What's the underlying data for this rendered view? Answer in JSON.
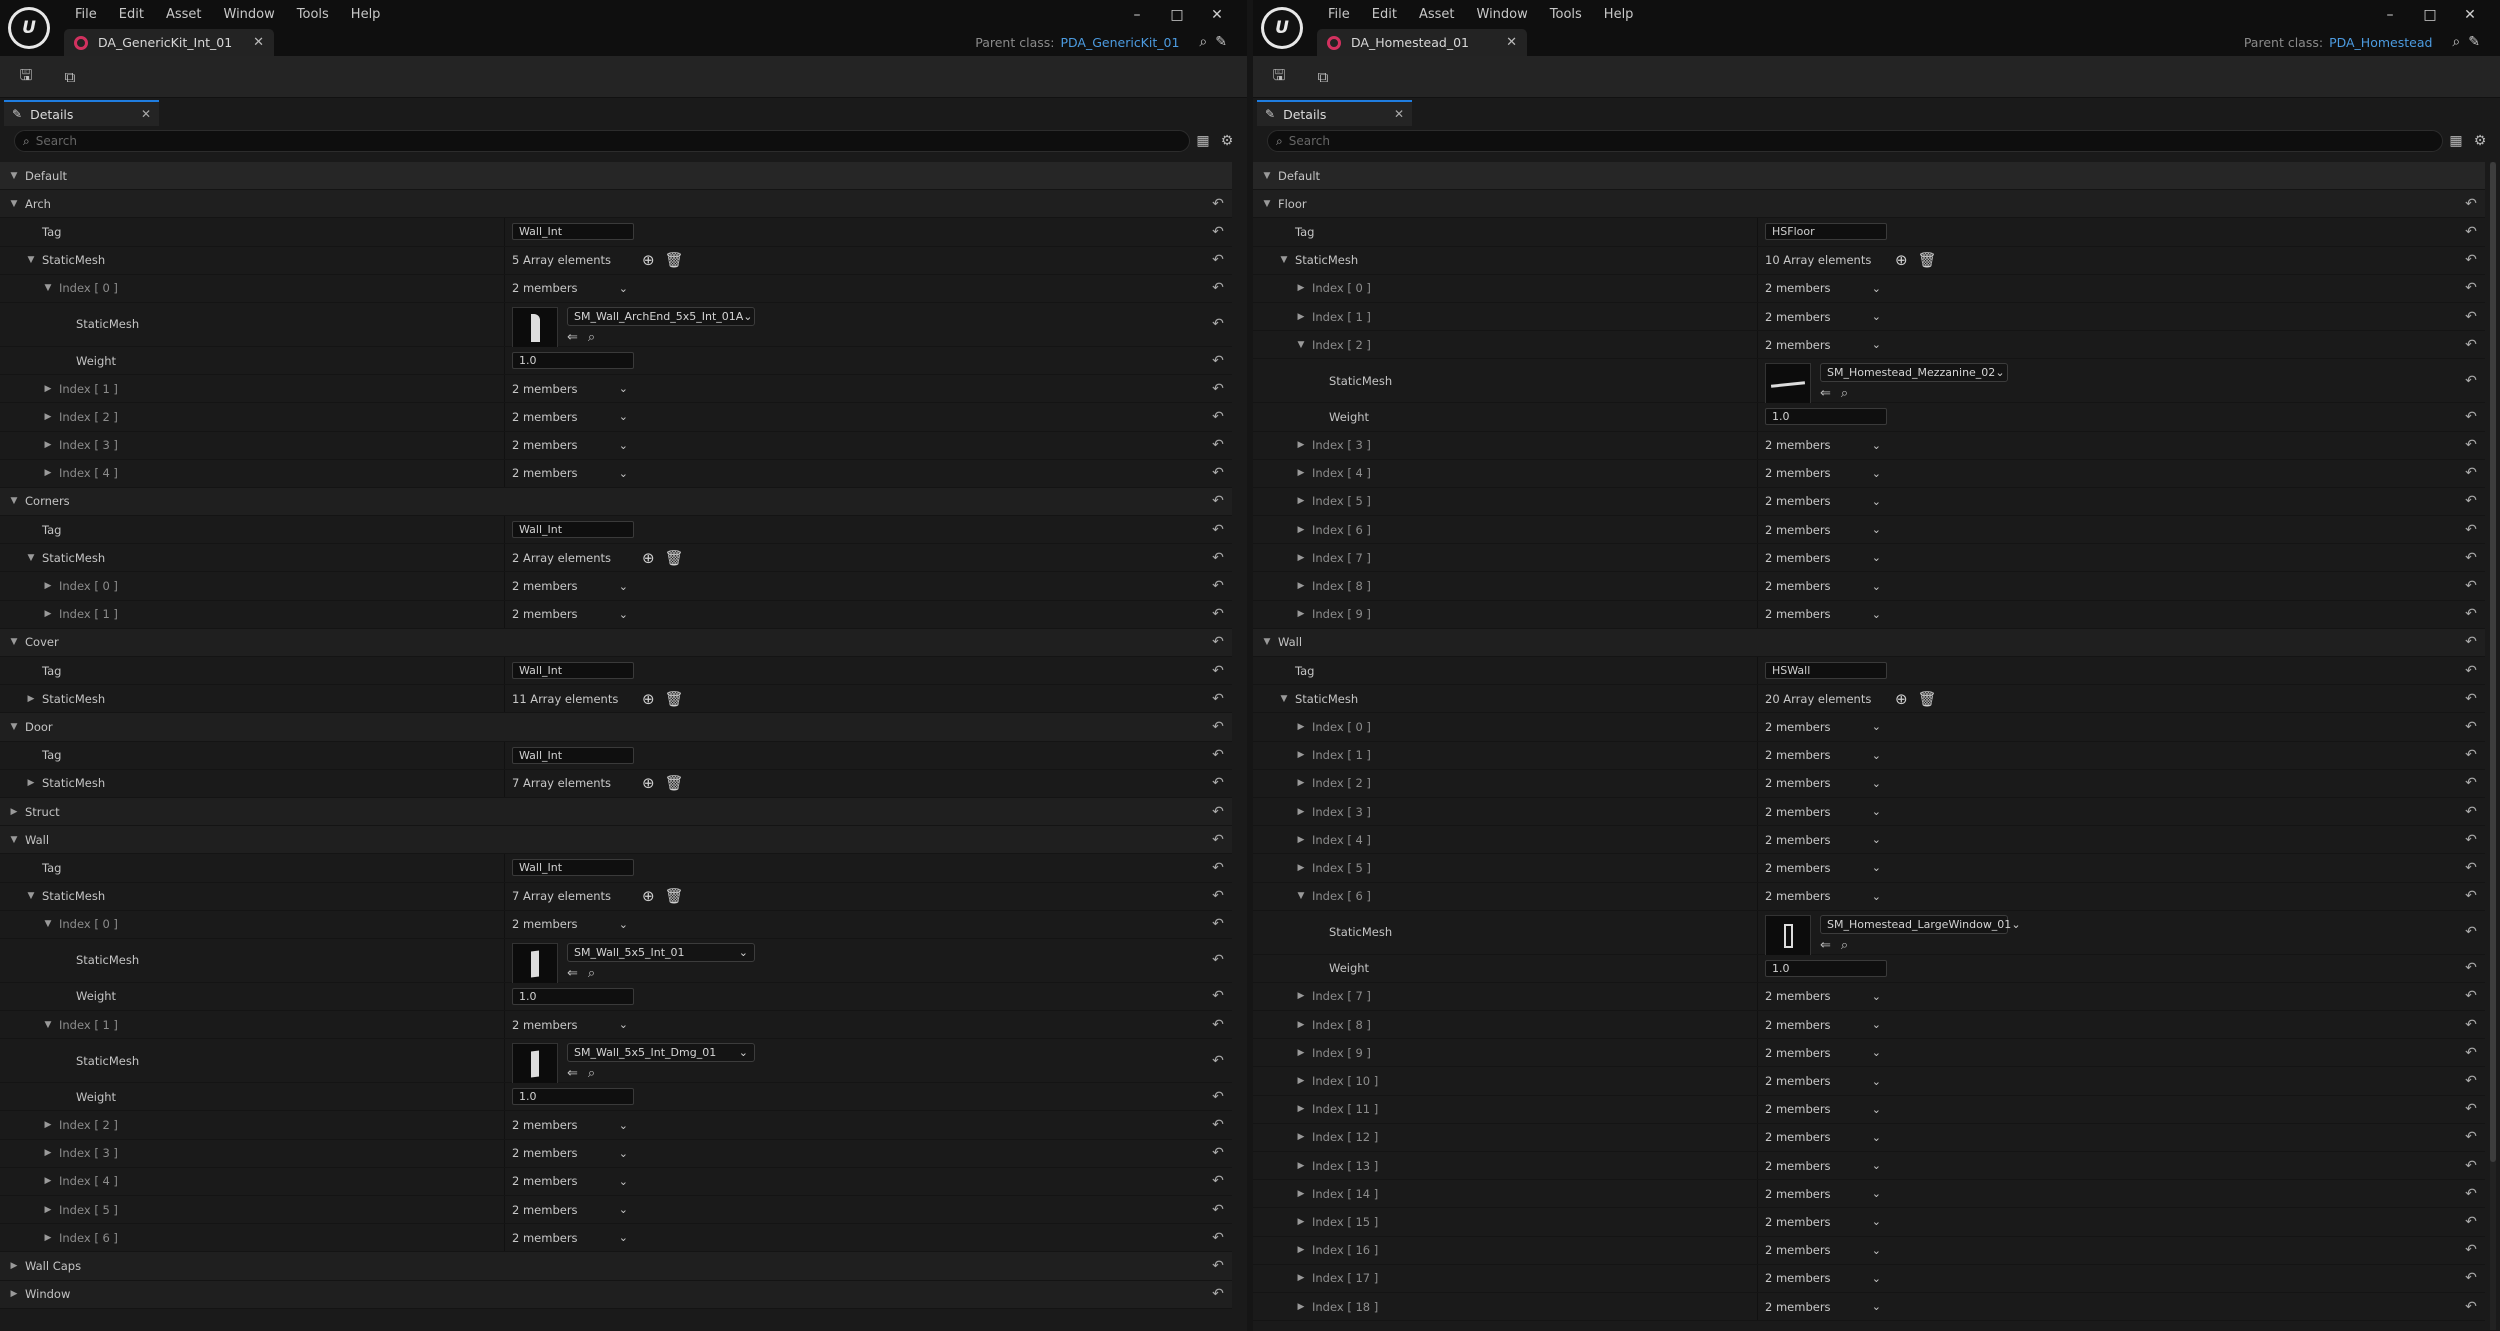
{
  "menu": [
    "File",
    "Edit",
    "Asset",
    "Window",
    "Tools",
    "Help"
  ],
  "window_buttons": [
    "–",
    "□",
    "✕"
  ],
  "panel_tab": "Details",
  "search_placeholder": "Search",
  "parent_class_label": "Parent class:",
  "left": {
    "doc_tab": "DA_GenericKit_Int_01",
    "parent_class": "PDA_GenericKit_01",
    "rows": [
      {
        "kind": "cat",
        "depth": 0,
        "tri": "down",
        "name": "Default"
      },
      {
        "kind": "sub",
        "depth": 0,
        "tri": "down",
        "name": "Arch"
      },
      {
        "kind": "prop",
        "depth": 1,
        "tri": "none",
        "name": "Tag",
        "val": "text",
        "text": "Wall_Int"
      },
      {
        "kind": "prop",
        "depth": 1,
        "tri": "down",
        "name": "StaticMesh",
        "val": "array",
        "text": "5 Array elements"
      },
      {
        "kind": "idx",
        "depth": 2,
        "tri": "down",
        "name": "Index [ 0 ]",
        "val": "members",
        "text": "2 members"
      },
      {
        "kind": "asset",
        "depth": 3,
        "tri": "none",
        "name": "StaticMesh",
        "val": "asset",
        "text": "SM_Wall_ArchEnd_5x5_Int_01A",
        "thumb": "arch"
      },
      {
        "kind": "prop",
        "depth": 3,
        "tri": "none",
        "name": "Weight",
        "val": "text",
        "text": "1.0"
      },
      {
        "kind": "idx",
        "depth": 2,
        "tri": "right",
        "name": "Index [ 1 ]",
        "val": "members",
        "text": "2 members"
      },
      {
        "kind": "idx",
        "depth": 2,
        "tri": "right",
        "name": "Index [ 2 ]",
        "val": "members",
        "text": "2 members"
      },
      {
        "kind": "idx",
        "depth": 2,
        "tri": "right",
        "name": "Index [ 3 ]",
        "val": "members",
        "text": "2 members"
      },
      {
        "kind": "idx",
        "depth": 2,
        "tri": "right",
        "name": "Index [ 4 ]",
        "val": "members",
        "text": "2 members"
      },
      {
        "kind": "sub",
        "depth": 0,
        "tri": "down",
        "name": "Corners"
      },
      {
        "kind": "prop",
        "depth": 1,
        "tri": "none",
        "name": "Tag",
        "val": "text",
        "text": "Wall_Int"
      },
      {
        "kind": "prop",
        "depth": 1,
        "tri": "down",
        "name": "StaticMesh",
        "val": "array",
        "text": "2 Array elements"
      },
      {
        "kind": "idx",
        "depth": 2,
        "tri": "right",
        "name": "Index [ 0 ]",
        "val": "members",
        "text": "2 members"
      },
      {
        "kind": "idx",
        "depth": 2,
        "tri": "right",
        "name": "Index [ 1 ]",
        "val": "members",
        "text": "2 members"
      },
      {
        "kind": "sub",
        "depth": 0,
        "tri": "down",
        "name": "Cover"
      },
      {
        "kind": "prop",
        "depth": 1,
        "tri": "none",
        "name": "Tag",
        "val": "text",
        "text": "Wall_Int"
      },
      {
        "kind": "prop",
        "depth": 1,
        "tri": "right",
        "name": "StaticMesh",
        "val": "array",
        "text": "11 Array elements"
      },
      {
        "kind": "sub",
        "depth": 0,
        "tri": "down",
        "name": "Door"
      },
      {
        "kind": "prop",
        "depth": 1,
        "tri": "none",
        "name": "Tag",
        "val": "text",
        "text": "Wall_Int"
      },
      {
        "kind": "prop",
        "depth": 1,
        "tri": "right",
        "name": "StaticMesh",
        "val": "array",
        "text": "7 Array elements"
      },
      {
        "kind": "sub",
        "depth": 0,
        "tri": "right",
        "name": "Struct"
      },
      {
        "kind": "sub",
        "depth": 0,
        "tri": "down",
        "name": "Wall"
      },
      {
        "kind": "prop",
        "depth": 1,
        "tri": "none",
        "name": "Tag",
        "val": "text",
        "text": "Wall_Int"
      },
      {
        "kind": "prop",
        "depth": 1,
        "tri": "down",
        "name": "StaticMesh",
        "val": "array",
        "text": "7 Array elements"
      },
      {
        "kind": "idx",
        "depth": 2,
        "tri": "down",
        "name": "Index [ 0 ]",
        "val": "members",
        "text": "2 members"
      },
      {
        "kind": "asset",
        "depth": 3,
        "tri": "none",
        "name": "StaticMesh",
        "val": "asset",
        "text": "SM_Wall_5x5_Int_01",
        "thumb": "wall"
      },
      {
        "kind": "prop",
        "depth": 3,
        "tri": "none",
        "name": "Weight",
        "val": "text",
        "text": "1.0"
      },
      {
        "kind": "idx",
        "depth": 2,
        "tri": "down",
        "name": "Index [ 1 ]",
        "val": "members",
        "text": "2 members"
      },
      {
        "kind": "asset",
        "depth": 3,
        "tri": "none",
        "name": "StaticMesh",
        "val": "asset",
        "text": "SM_Wall_5x5_Int_Dmg_01",
        "thumb": "wall"
      },
      {
        "kind": "prop",
        "depth": 3,
        "tri": "none",
        "name": "Weight",
        "val": "text",
        "text": "1.0"
      },
      {
        "kind": "idx",
        "depth": 2,
        "tri": "right",
        "name": "Index [ 2 ]",
        "val": "members",
        "text": "2 members"
      },
      {
        "kind": "idx",
        "depth": 2,
        "tri": "right",
        "name": "Index [ 3 ]",
        "val": "members",
        "text": "2 members"
      },
      {
        "kind": "idx",
        "depth": 2,
        "tri": "right",
        "name": "Index [ 4 ]",
        "val": "members",
        "text": "2 members"
      },
      {
        "kind": "idx",
        "depth": 2,
        "tri": "right",
        "name": "Index [ 5 ]",
        "val": "members",
        "text": "2 members"
      },
      {
        "kind": "idx",
        "depth": 2,
        "tri": "right",
        "name": "Index [ 6 ]",
        "val": "members",
        "text": "2 members"
      },
      {
        "kind": "sub",
        "depth": 0,
        "tri": "right",
        "name": "Wall Caps"
      },
      {
        "kind": "sub",
        "depth": 0,
        "tri": "right",
        "name": "Window"
      }
    ]
  },
  "right": {
    "doc_tab": "DA_Homestead_01",
    "parent_class": "PDA_Homestead",
    "rows": [
      {
        "kind": "cat",
        "depth": 0,
        "tri": "down",
        "name": "Default"
      },
      {
        "kind": "sub",
        "depth": 0,
        "tri": "down",
        "name": "Floor"
      },
      {
        "kind": "prop",
        "depth": 1,
        "tri": "none",
        "name": "Tag",
        "val": "text",
        "text": "HSFloor"
      },
      {
        "kind": "prop",
        "depth": 1,
        "tri": "down",
        "name": "StaticMesh",
        "val": "array",
        "text": "10 Array elements"
      },
      {
        "kind": "idx",
        "depth": 2,
        "tri": "right",
        "name": "Index [ 0 ]",
        "val": "members",
        "text": "2 members"
      },
      {
        "kind": "idx",
        "depth": 2,
        "tri": "right",
        "name": "Index [ 1 ]",
        "val": "members",
        "text": "2 members"
      },
      {
        "kind": "idx",
        "depth": 2,
        "tri": "down",
        "name": "Index [ 2 ]",
        "val": "members",
        "text": "2 members"
      },
      {
        "kind": "asset",
        "depth": 3,
        "tri": "none",
        "name": "StaticMesh",
        "val": "asset",
        "text": "SM_Homestead_Mezzanine_02",
        "thumb": "flat"
      },
      {
        "kind": "prop",
        "depth": 3,
        "tri": "none",
        "name": "Weight",
        "val": "text",
        "text": "1.0"
      },
      {
        "kind": "idx",
        "depth": 2,
        "tri": "right",
        "name": "Index [ 3 ]",
        "val": "members",
        "text": "2 members"
      },
      {
        "kind": "idx",
        "depth": 2,
        "tri": "right",
        "name": "Index [ 4 ]",
        "val": "members",
        "text": "2 members"
      },
      {
        "kind": "idx",
        "depth": 2,
        "tri": "right",
        "name": "Index [ 5 ]",
        "val": "members",
        "text": "2 members"
      },
      {
        "kind": "idx",
        "depth": 2,
        "tri": "right",
        "name": "Index [ 6 ]",
        "val": "members",
        "text": "2 members"
      },
      {
        "kind": "idx",
        "depth": 2,
        "tri": "right",
        "name": "Index [ 7 ]",
        "val": "members",
        "text": "2 members"
      },
      {
        "kind": "idx",
        "depth": 2,
        "tri": "right",
        "name": "Index [ 8 ]",
        "val": "members",
        "text": "2 members"
      },
      {
        "kind": "idx",
        "depth": 2,
        "tri": "right",
        "name": "Index [ 9 ]",
        "val": "members",
        "text": "2 members"
      },
      {
        "kind": "sub",
        "depth": 0,
        "tri": "down",
        "name": "Wall"
      },
      {
        "kind": "prop",
        "depth": 1,
        "tri": "none",
        "name": "Tag",
        "val": "text",
        "text": "HSWall"
      },
      {
        "kind": "prop",
        "depth": 1,
        "tri": "down",
        "name": "StaticMesh",
        "val": "array",
        "text": "20 Array elements"
      },
      {
        "kind": "idx",
        "depth": 2,
        "tri": "right",
        "name": "Index [ 0 ]",
        "val": "members",
        "text": "2 members"
      },
      {
        "kind": "idx",
        "depth": 2,
        "tri": "right",
        "name": "Index [ 1 ]",
        "val": "members",
        "text": "2 members"
      },
      {
        "kind": "idx",
        "depth": 2,
        "tri": "right",
        "name": "Index [ 2 ]",
        "val": "members",
        "text": "2 members"
      },
      {
        "kind": "idx",
        "depth": 2,
        "tri": "right",
        "name": "Index [ 3 ]",
        "val": "members",
        "text": "2 members"
      },
      {
        "kind": "idx",
        "depth": 2,
        "tri": "right",
        "name": "Index [ 4 ]",
        "val": "members",
        "text": "2 members"
      },
      {
        "kind": "idx",
        "depth": 2,
        "tri": "right",
        "name": "Index [ 5 ]",
        "val": "members",
        "text": "2 members"
      },
      {
        "kind": "idx",
        "depth": 2,
        "tri": "down",
        "name": "Index [ 6 ]",
        "val": "members",
        "text": "2 members"
      },
      {
        "kind": "asset",
        "depth": 3,
        "tri": "none",
        "name": "StaticMesh",
        "val": "asset",
        "text": "SM_Homestead_LargeWindow_01",
        "thumb": "window"
      },
      {
        "kind": "prop",
        "depth": 3,
        "tri": "none",
        "name": "Weight",
        "val": "text",
        "text": "1.0"
      },
      {
        "kind": "idx",
        "depth": 2,
        "tri": "right",
        "name": "Index [ 7 ]",
        "val": "members",
        "text": "2 members"
      },
      {
        "kind": "idx",
        "depth": 2,
        "tri": "right",
        "name": "Index [ 8 ]",
        "val": "members",
        "text": "2 members"
      },
      {
        "kind": "idx",
        "depth": 2,
        "tri": "right",
        "name": "Index [ 9 ]",
        "val": "members",
        "text": "2 members"
      },
      {
        "kind": "idx",
        "depth": 2,
        "tri": "right",
        "name": "Index [ 10 ]",
        "val": "members",
        "text": "2 members"
      },
      {
        "kind": "idx",
        "depth": 2,
        "tri": "right",
        "name": "Index [ 11 ]",
        "val": "members",
        "text": "2 members"
      },
      {
        "kind": "idx",
        "depth": 2,
        "tri": "right",
        "name": "Index [ 12 ]",
        "val": "members",
        "text": "2 members"
      },
      {
        "kind": "idx",
        "depth": 2,
        "tri": "right",
        "name": "Index [ 13 ]",
        "val": "members",
        "text": "2 members"
      },
      {
        "kind": "idx",
        "depth": 2,
        "tri": "right",
        "name": "Index [ 14 ]",
        "val": "members",
        "text": "2 members"
      },
      {
        "kind": "idx",
        "depth": 2,
        "tri": "right",
        "name": "Index [ 15 ]",
        "val": "members",
        "text": "2 members"
      },
      {
        "kind": "idx",
        "depth": 2,
        "tri": "right",
        "name": "Index [ 16 ]",
        "val": "members",
        "text": "2 members"
      },
      {
        "kind": "idx",
        "depth": 2,
        "tri": "right",
        "name": "Index [ 17 ]",
        "val": "members",
        "text": "2 members"
      },
      {
        "kind": "idx",
        "depth": 2,
        "tri": "right",
        "name": "Index [ 18 ]",
        "val": "members",
        "text": "2 members"
      }
    ]
  },
  "icons": {
    "reset": "reset-to-default-icon",
    "add": "add-element-icon",
    "delete": "trash-icon",
    "browse": "browse-to-asset-icon",
    "use": "use-selected-asset-icon"
  },
  "colors": {
    "accent": "#1f7de0",
    "asset_tab": "#d2315f",
    "link": "#4c9be0",
    "thumb_bar": "#1fb6d6"
  }
}
